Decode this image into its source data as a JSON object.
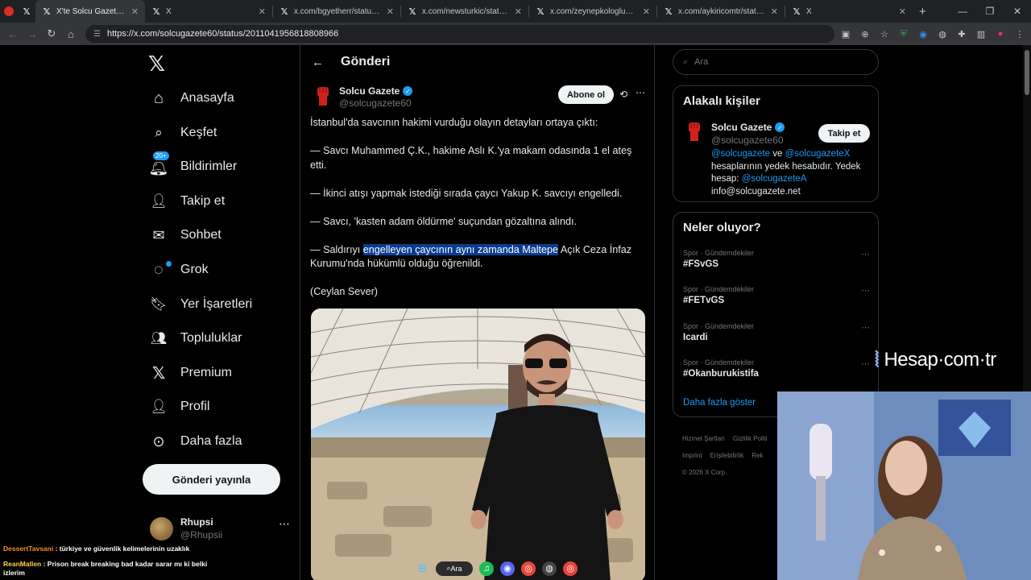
{
  "browser": {
    "tabs": [
      {
        "title": "",
        "fav": "red"
      },
      {
        "title": "",
        "fav": "x"
      },
      {
        "title": "X'te Solcu Gazete: \"İstanbul'",
        "fav": "x",
        "active": true
      },
      {
        "title": "X",
        "fav": "x"
      },
      {
        "title": "x.com/bgyetherr/status/20110",
        "fav": "x"
      },
      {
        "title": "x.com/newsturkic/status/2011",
        "fav": "x"
      },
      {
        "title": "x.com/zeynepkologluu/status/2",
        "fav": "x"
      },
      {
        "title": "x.com/aykiricomtr/status/2011",
        "fav": "x"
      },
      {
        "title": "X",
        "fav": "x"
      }
    ],
    "url": "https://x.com/solcugazete60/status/2011041956818808966"
  },
  "nav": {
    "items": [
      {
        "label": "Anasayfa",
        "icon": "home-icon"
      },
      {
        "label": "Keşfet",
        "icon": "search-icon"
      },
      {
        "label": "Bildirimler",
        "icon": "bell-icon"
      },
      {
        "label": "Takip et",
        "icon": "person-add-icon"
      },
      {
        "label": "Sohbet",
        "icon": "mail-icon"
      },
      {
        "label": "Grok",
        "icon": "grok-icon"
      },
      {
        "label": "Yer İşaretleri",
        "icon": "bookmark-icon"
      },
      {
        "label": "Topluluklar",
        "icon": "communities-icon"
      },
      {
        "label": "Premium",
        "icon": "x-logo-icon"
      },
      {
        "label": "Profil",
        "icon": "person-icon"
      },
      {
        "label": "Daha fazla",
        "icon": "more-circle-icon"
      }
    ],
    "notif_badge": "20+",
    "post_button": "Gönderi yayınla",
    "profile": {
      "name": "Rhupsi",
      "handle": "@Rhupsii"
    }
  },
  "post": {
    "page_title": "Gönderi",
    "author": {
      "name": "Solcu Gazete",
      "handle": "@solcugazete60"
    },
    "subscribe_label": "Abone ol",
    "paragraphs": [
      "İstanbul'da savcının hakimi vurduğu olayın detayları ortaya çıktı:",
      "— Savcı Muhammed Ç.K., hakime Aslı K.'ya makam odasında 1 el ateş etti.",
      "— İkinci atışı yapmak istediği sırada çaycı Yakup K. savcıyı engelledi.",
      "— Savcı, 'kasten adam öldürme' suçundan gözaltına alındı."
    ],
    "last_para": {
      "before": "— Saldırıyı ",
      "highlight": "engelleyen çaycının aynı zamanda Maltepe",
      "after": " Açık Ceza İnfaz Kurumu'nda hükümlü olduğu öğrenildi."
    },
    "credit": "(Ceylan Sever)"
  },
  "sidebar": {
    "search_placeholder": "Ara",
    "related": {
      "title": "Alakalı kişiler",
      "name": "Solcu Gazete",
      "handle": "@solcugazete60",
      "follow_label": "Takip et",
      "bio_m1": "@solcugazete",
      "bio_ve": " ve ",
      "bio_m2": "@solcugazeteX",
      "bio_mid": " hesaplarının yedek hesabıdır. Yedek hesap: ",
      "bio_m3": "@solcugazeteA",
      "bio_email": "info@solcugazete.net"
    },
    "trends": {
      "title": "Neler oluyor?",
      "items": [
        {
          "category": "Spor · Gündemdekiler",
          "tag": "#FSvGS"
        },
        {
          "category": "Spor · Gündemdekiler",
          "tag": "#FETvGS"
        },
        {
          "category": "Spor · Gündemdekiler",
          "tag": "Icardi"
        },
        {
          "category": "Spor · Gündemdekiler",
          "tag": "#Okanburukistifa"
        }
      ],
      "show_more": "Daha fazla göster"
    },
    "footer": [
      "Hizmet Şartları",
      "Gizlilik Politi",
      "Imprint",
      "Erişilebilirlik",
      "Rek",
      "© 2026 X Corp."
    ]
  },
  "overlay": {
    "watermark": "Hesap·com·tr",
    "chat": [
      {
        "user": "DessertTavsani",
        "msg": " : türkiye ve güvenlik kelimelerinin uzaklık"
      },
      {
        "user": "ReanMallen",
        "msg": " : Prison break breaking bad kadar sarar mı ki belki izlerim"
      }
    ]
  },
  "taskbar": {
    "search_label": "Ara"
  }
}
